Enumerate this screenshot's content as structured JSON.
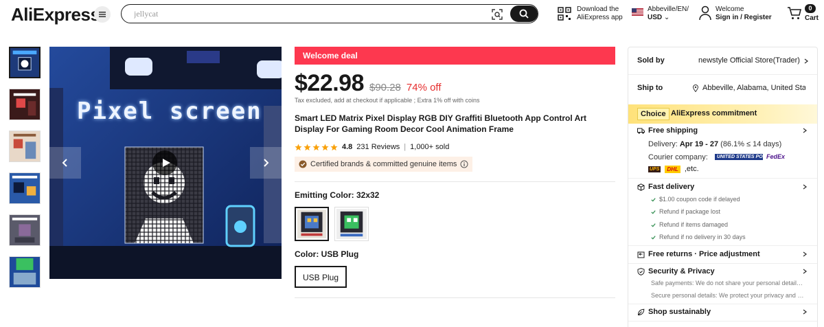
{
  "header": {
    "logo": "AliExpress",
    "search_placeholder": "jellycat",
    "download_app": [
      "Download the",
      "AliExpress app"
    ],
    "region_line1": "Abbeville/EN/",
    "region_line2": "USD",
    "welcome": "Welcome",
    "signin": "Sign in / Register",
    "cart_count": "0",
    "cart_label": "Cart"
  },
  "gallery": {
    "overlay_title": "Pixel screen",
    "thumb_count": 6
  },
  "product": {
    "deal_label": "Welcome deal",
    "price": "$22.98",
    "original_price": "$90.28",
    "discount": "74% off",
    "tax_note": "Tax excluded, add at checkout if applicable ; Extra 1% off with coins",
    "title": "Smart LED Matrix Pixel Display RGB DIY Graffiti Bluetooth App Control Art Display For Gaming Room Decor Cool Animation Frame",
    "rating": "4.8",
    "stars": 5,
    "reviews": "231 Reviews",
    "sold": "1,000+ sold",
    "certified": "Certified brands & committed genuine items",
    "emitting_color_label": "Emitting Color: 32x32",
    "color_label": "Color: USB Plug",
    "plug_option": "USB Plug"
  },
  "panel": {
    "sold_by_label": "Sold by",
    "sold_by_value": "newstyle Official Store(Trader)",
    "ship_to_label": "Ship to",
    "ship_to_value": "Abbeville, Alabama, United States",
    "choice_tag": "Choice",
    "commitment": "AliExpress commitment",
    "free_shipping": "Free shipping",
    "delivery_prefix": "Delivery: ",
    "delivery_dates": "Apr 19 - 27",
    "delivery_suffix": " (86.1% ≤ 14 days)",
    "courier_label": "Courier company:",
    "courier_usps": "UNITED STATES POSTAL SERVICE",
    "courier_fedex": "FedEx",
    "courier_ups": "UPS",
    "courier_dhl": "DHL",
    "courier_etc": ",etc.",
    "fast_delivery": "Fast delivery",
    "fast_items": [
      "$1.00 coupon code if delayed",
      "Refund if package lost",
      "Refund if items damaged",
      "Refund if no delivery in 30 days"
    ],
    "free_returns": "Free returns · Price adjustment",
    "security": "Security & Privacy",
    "safe_payments": "Safe payments: We do not share your personal details with any third-party sellers without your consent.",
    "secure_details": "Secure personal details: We protect your privacy and keep your personal details safe and secure.",
    "shop_sustainably": "Shop sustainably"
  }
}
